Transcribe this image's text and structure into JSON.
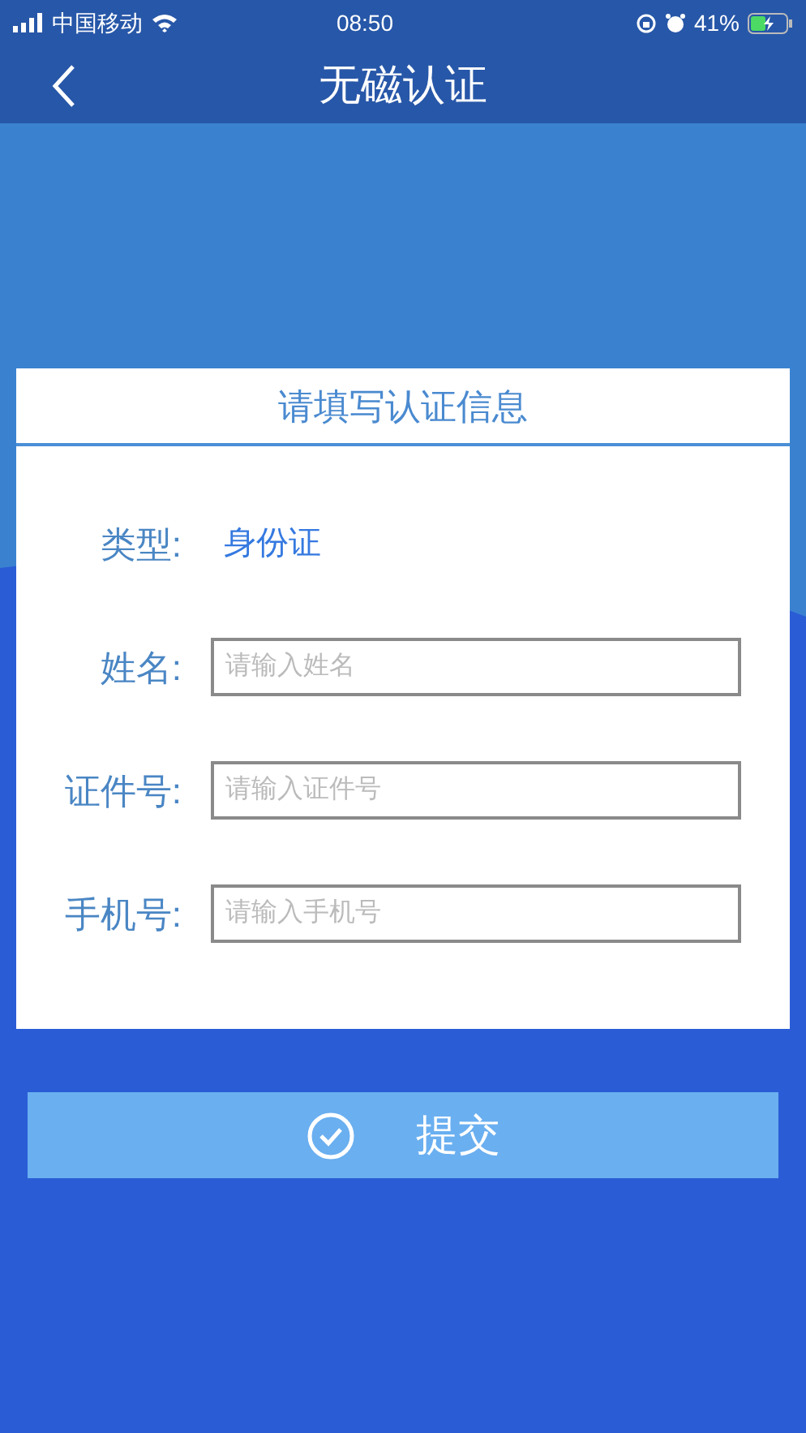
{
  "status_bar": {
    "carrier": "中国移动",
    "time": "08:50",
    "battery": "41%"
  },
  "nav": {
    "title": "无磁认证"
  },
  "form": {
    "title": "请填写认证信息",
    "rows": [
      {
        "kind": "text",
        "label": "类型:",
        "value": "身份证"
      },
      {
        "kind": "input",
        "label": "姓名:",
        "placeholder": "请输入姓名"
      },
      {
        "kind": "input",
        "label": "证件号:",
        "placeholder": "请输入证件号"
      },
      {
        "kind": "input",
        "label": "手机号:",
        "placeholder": "请输入手机号"
      }
    ]
  },
  "submit": {
    "label": "提交"
  }
}
